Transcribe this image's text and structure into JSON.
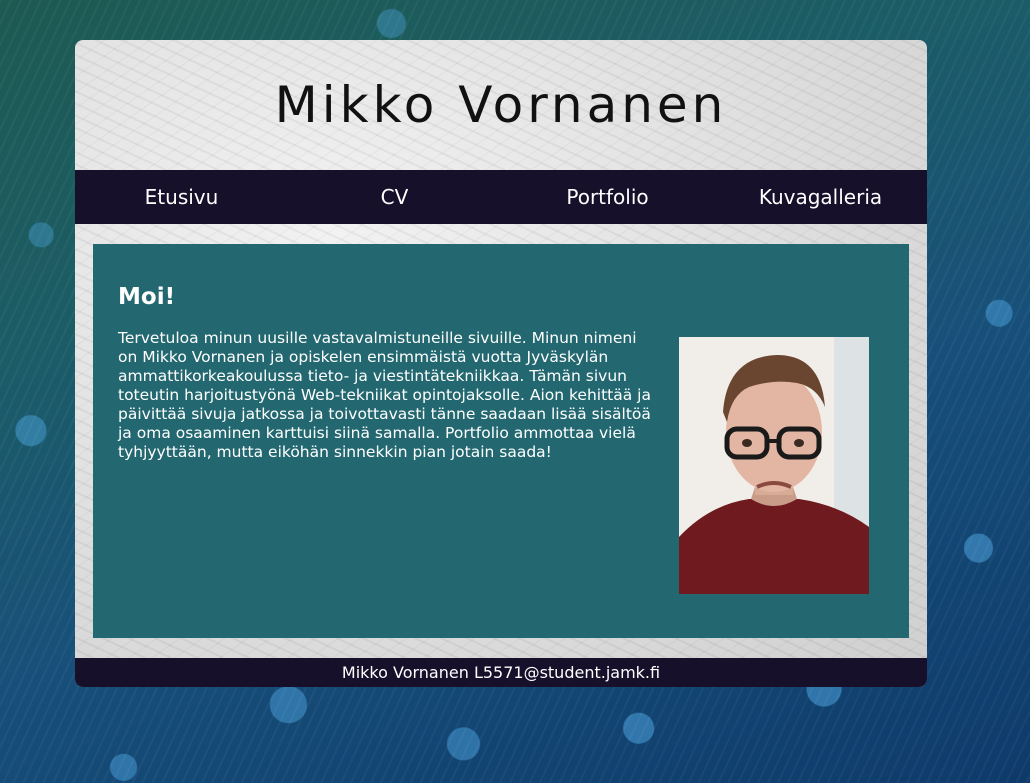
{
  "header": {
    "title": "Mikko Vornanen"
  },
  "nav": {
    "items": [
      {
        "label": "Etusivu"
      },
      {
        "label": "CV"
      },
      {
        "label": "Portfolio"
      },
      {
        "label": "Kuvagalleria"
      }
    ]
  },
  "main": {
    "heading": "Moi!",
    "text": "Tervetuloa minun uusille vastavalmistuneille sivuille. Minun nimeni on Mikko Vornanen ja opiskelen ensimmäistä vuotta Jyväskylän ammattikorkeakoulussa tieto- ja viestintätekniikkaa. Tämän sivun toteutin harjoitustyönä Web-tekniikat opintojaksolle. Aion kehittää ja päivittää sivuja jatkossa ja toivottavasti tänne saadaan lisää sisältöä ja oma osaaminen karttuisi siinä samalla. Portfolio ammottaa vielä tyhjyyttään, mutta eiköhän sinnekkin pian jotain saada!"
  },
  "footer": {
    "text": "Mikko Vornanen L5571@student.jamk.fi"
  },
  "colors": {
    "nav_background": "#16102a",
    "content_background": "#236870",
    "text_light": "#ffffff",
    "title_text": "#111111"
  }
}
